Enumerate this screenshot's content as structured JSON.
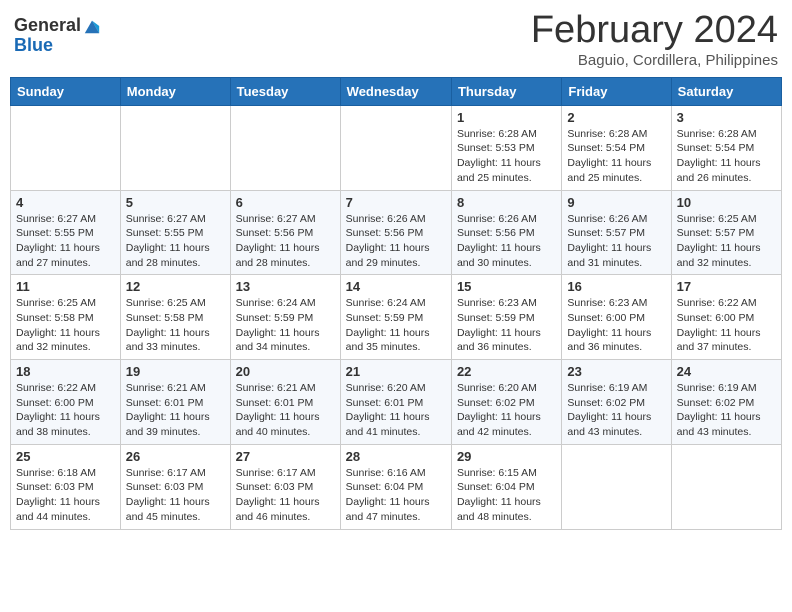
{
  "logo": {
    "general": "General",
    "blue": "Blue"
  },
  "title": {
    "month": "February 2024",
    "location": "Baguio, Cordillera, Philippines"
  },
  "headers": [
    "Sunday",
    "Monday",
    "Tuesday",
    "Wednesday",
    "Thursday",
    "Friday",
    "Saturday"
  ],
  "weeks": [
    [
      {
        "day": "",
        "info": ""
      },
      {
        "day": "",
        "info": ""
      },
      {
        "day": "",
        "info": ""
      },
      {
        "day": "",
        "info": ""
      },
      {
        "day": "1",
        "info": "Sunrise: 6:28 AM\nSunset: 5:53 PM\nDaylight: 11 hours and 25 minutes."
      },
      {
        "day": "2",
        "info": "Sunrise: 6:28 AM\nSunset: 5:54 PM\nDaylight: 11 hours and 25 minutes."
      },
      {
        "day": "3",
        "info": "Sunrise: 6:28 AM\nSunset: 5:54 PM\nDaylight: 11 hours and 26 minutes."
      }
    ],
    [
      {
        "day": "4",
        "info": "Sunrise: 6:27 AM\nSunset: 5:55 PM\nDaylight: 11 hours and 27 minutes."
      },
      {
        "day": "5",
        "info": "Sunrise: 6:27 AM\nSunset: 5:55 PM\nDaylight: 11 hours and 28 minutes."
      },
      {
        "day": "6",
        "info": "Sunrise: 6:27 AM\nSunset: 5:56 PM\nDaylight: 11 hours and 28 minutes."
      },
      {
        "day": "7",
        "info": "Sunrise: 6:26 AM\nSunset: 5:56 PM\nDaylight: 11 hours and 29 minutes."
      },
      {
        "day": "8",
        "info": "Sunrise: 6:26 AM\nSunset: 5:56 PM\nDaylight: 11 hours and 30 minutes."
      },
      {
        "day": "9",
        "info": "Sunrise: 6:26 AM\nSunset: 5:57 PM\nDaylight: 11 hours and 31 minutes."
      },
      {
        "day": "10",
        "info": "Sunrise: 6:25 AM\nSunset: 5:57 PM\nDaylight: 11 hours and 32 minutes."
      }
    ],
    [
      {
        "day": "11",
        "info": "Sunrise: 6:25 AM\nSunset: 5:58 PM\nDaylight: 11 hours and 32 minutes."
      },
      {
        "day": "12",
        "info": "Sunrise: 6:25 AM\nSunset: 5:58 PM\nDaylight: 11 hours and 33 minutes."
      },
      {
        "day": "13",
        "info": "Sunrise: 6:24 AM\nSunset: 5:59 PM\nDaylight: 11 hours and 34 minutes."
      },
      {
        "day": "14",
        "info": "Sunrise: 6:24 AM\nSunset: 5:59 PM\nDaylight: 11 hours and 35 minutes."
      },
      {
        "day": "15",
        "info": "Sunrise: 6:23 AM\nSunset: 5:59 PM\nDaylight: 11 hours and 36 minutes."
      },
      {
        "day": "16",
        "info": "Sunrise: 6:23 AM\nSunset: 6:00 PM\nDaylight: 11 hours and 36 minutes."
      },
      {
        "day": "17",
        "info": "Sunrise: 6:22 AM\nSunset: 6:00 PM\nDaylight: 11 hours and 37 minutes."
      }
    ],
    [
      {
        "day": "18",
        "info": "Sunrise: 6:22 AM\nSunset: 6:00 PM\nDaylight: 11 hours and 38 minutes."
      },
      {
        "day": "19",
        "info": "Sunrise: 6:21 AM\nSunset: 6:01 PM\nDaylight: 11 hours and 39 minutes."
      },
      {
        "day": "20",
        "info": "Sunrise: 6:21 AM\nSunset: 6:01 PM\nDaylight: 11 hours and 40 minutes."
      },
      {
        "day": "21",
        "info": "Sunrise: 6:20 AM\nSunset: 6:01 PM\nDaylight: 11 hours and 41 minutes."
      },
      {
        "day": "22",
        "info": "Sunrise: 6:20 AM\nSunset: 6:02 PM\nDaylight: 11 hours and 42 minutes."
      },
      {
        "day": "23",
        "info": "Sunrise: 6:19 AM\nSunset: 6:02 PM\nDaylight: 11 hours and 43 minutes."
      },
      {
        "day": "24",
        "info": "Sunrise: 6:19 AM\nSunset: 6:02 PM\nDaylight: 11 hours and 43 minutes."
      }
    ],
    [
      {
        "day": "25",
        "info": "Sunrise: 6:18 AM\nSunset: 6:03 PM\nDaylight: 11 hours and 44 minutes."
      },
      {
        "day": "26",
        "info": "Sunrise: 6:17 AM\nSunset: 6:03 PM\nDaylight: 11 hours and 45 minutes."
      },
      {
        "day": "27",
        "info": "Sunrise: 6:17 AM\nSunset: 6:03 PM\nDaylight: 11 hours and 46 minutes."
      },
      {
        "day": "28",
        "info": "Sunrise: 6:16 AM\nSunset: 6:04 PM\nDaylight: 11 hours and 47 minutes."
      },
      {
        "day": "29",
        "info": "Sunrise: 6:15 AM\nSunset: 6:04 PM\nDaylight: 11 hours and 48 minutes."
      },
      {
        "day": "",
        "info": ""
      },
      {
        "day": "",
        "info": ""
      }
    ]
  ]
}
